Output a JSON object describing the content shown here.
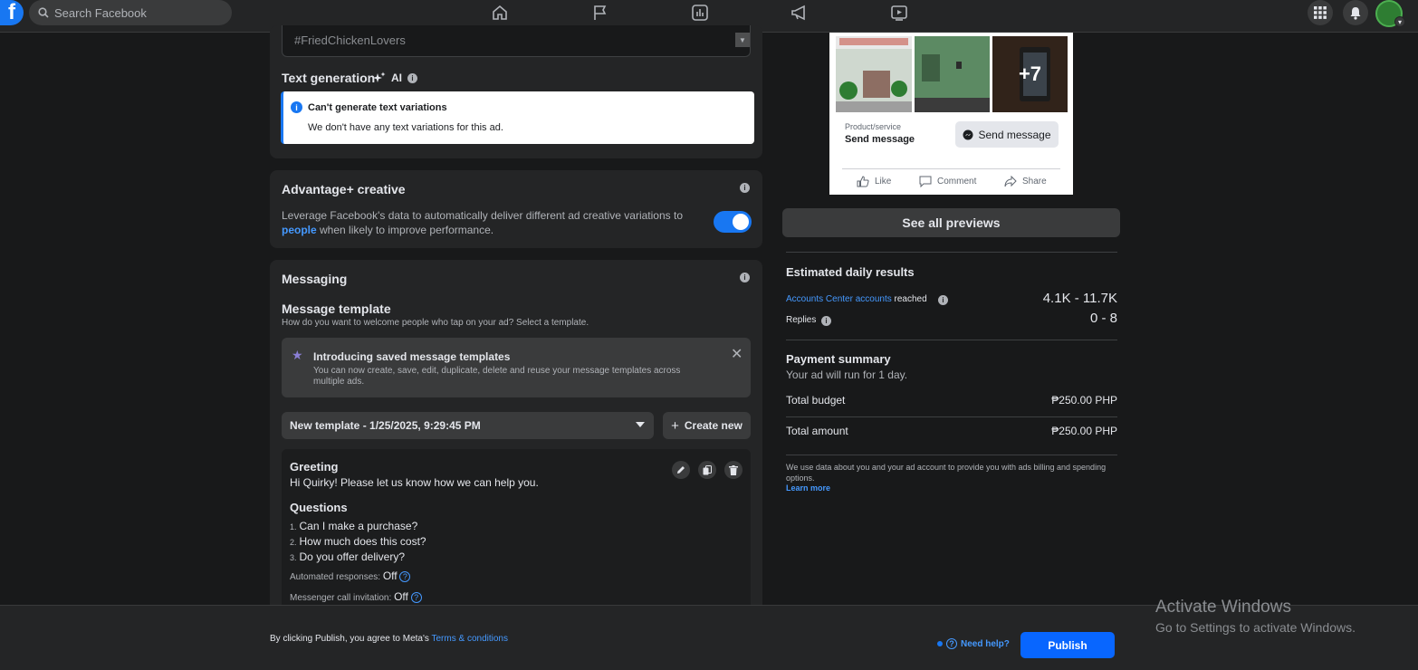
{
  "nav": {
    "logo": "f",
    "search_placeholder": "Search Facebook",
    "icons": [
      "home-icon",
      "flag-icon",
      "chart-icon",
      "megaphone-icon",
      "play-video-icon"
    ],
    "right_icons": [
      "menu-grid-icon",
      "bell-icon"
    ]
  },
  "text_section": {
    "hashtags": "#FriedChickenLovers",
    "text_generation_title": "Text generation",
    "ai_label": "AI",
    "notice_title": "Can't generate text variations",
    "notice_body": "We don't have any text variations for this ad."
  },
  "advantage": {
    "title": "Advantage+ creative",
    "desc_prefix": "Leverage Facebook's data to automatically deliver different ad creative variations to",
    "link": "people",
    "desc_suffix": "when likely to improve performance.",
    "toggle_on": true
  },
  "messaging": {
    "title": "Messaging",
    "template_title": "Message template",
    "template_desc": "How do you want to welcome people who tap on your ad? Select a template.",
    "intro_title": "Introducing saved message templates",
    "intro_body": "You can now create, save, edit, duplicate, delete and reuse your message templates across multiple ads.",
    "selected_template": "New template - 1/25/2025, 9:29:45 PM",
    "create_new": "Create new",
    "greeting_title": "Greeting",
    "greeting_text": "Hi Quirky! Please let us know how we can help you.",
    "questions_title": "Questions",
    "questions": [
      {
        "num": "1.",
        "text": "Can I make a purchase?"
      },
      {
        "num": "2.",
        "text": "How much does this cost?"
      },
      {
        "num": "3.",
        "text": "Do you offer delivery?"
      }
    ],
    "automated_label": "Automated responses:",
    "automated_value": "Off",
    "call_label": "Messenger call invitation:",
    "call_value": "Off"
  },
  "preview": {
    "more_count": "+7",
    "cta_label": "Product/service",
    "cta_text": "Send message",
    "send_button": "Send message",
    "like": "Like",
    "comment": "Comment",
    "share": "Share",
    "see_all": "See all previews"
  },
  "results": {
    "title": "Estimated daily results",
    "accounts_link": "Accounts Center accounts",
    "accounts_suffix": "reached",
    "accounts_value": "4.1K - 11.7K",
    "replies_label": "Replies",
    "replies_value": "0 - 8"
  },
  "payment": {
    "title": "Payment summary",
    "subtitle": "Your ad will run for 1 day.",
    "budget_label": "Total budget",
    "budget_value": "₱250.00 PHP",
    "amount_label": "Total amount",
    "amount_value": "₱250.00 PHP",
    "disclaimer": "We use data about you and your ad account to provide you with ads billing and spending options.",
    "learn_more": "Learn more"
  },
  "footer": {
    "agree_text": "By clicking Publish, you agree to Meta's",
    "terms_link": "Terms & conditions",
    "help": "Need help?",
    "publish": "Publish"
  },
  "watermark": {
    "line1": "Activate Windows",
    "line2": "Go to Settings to activate Windows."
  },
  "colors": {
    "accent": "#1877f2",
    "publish": "#0866ff",
    "background": "#18191a",
    "card": "#242526"
  }
}
